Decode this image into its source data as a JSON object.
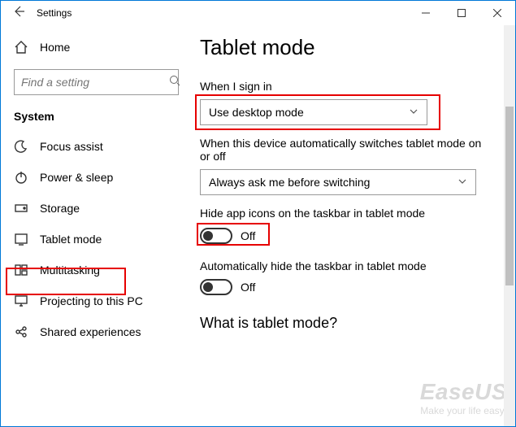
{
  "window": {
    "title": "Settings"
  },
  "sidebar": {
    "home": "Home",
    "search_placeholder": "Find a setting",
    "group": "System",
    "items": [
      {
        "label": "Focus assist"
      },
      {
        "label": "Power & sleep"
      },
      {
        "label": "Storage"
      },
      {
        "label": "Tablet mode"
      },
      {
        "label": "Multitasking"
      },
      {
        "label": "Projecting to this PC"
      },
      {
        "label": "Shared experiences"
      }
    ]
  },
  "content": {
    "heading": "Tablet mode",
    "signin_label": "When I sign in",
    "signin_value": "Use desktop mode",
    "autoswitch_label": "When this device automatically switches tablet mode on or off",
    "autoswitch_value": "Always ask me before switching",
    "hideicons_label": "Hide app icons on the taskbar in tablet mode",
    "hideicons_state": "Off",
    "autohide_label": "Automatically hide the taskbar in tablet mode",
    "autohide_state": "Off",
    "question": "What is tablet mode?"
  },
  "watermark": {
    "brand": "EaseUS",
    "tagline": "Make your life easy!"
  }
}
